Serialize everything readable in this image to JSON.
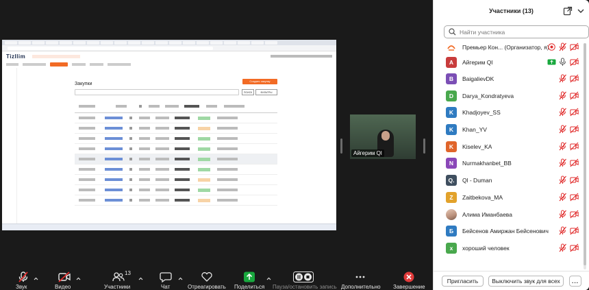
{
  "shared_screen": {
    "app_logo": "TizIlim",
    "page_title": "Закупки",
    "create_button": "Создать закупку",
    "search_button": "ПОИСК",
    "filters_button": "ФИЛЬТРЫ"
  },
  "video_tile": {
    "name": "Айгерим Ql"
  },
  "panel": {
    "title": "Участники (13)",
    "search_placeholder": "Найти участника",
    "participants": [
      {
        "name": "Премьер Кон... (Организатор, я)",
        "initial": "",
        "color": "#ffffff",
        "avatar": "logo"
      },
      {
        "name": "Айгерим Ql",
        "initial": "А",
        "color": "#c83c3c"
      },
      {
        "name": "BaigalievDK",
        "initial": "B",
        "color": "#7b4fb5"
      },
      {
        "name": "Darya_Kondratyeva",
        "initial": "D",
        "color": "#49a84d"
      },
      {
        "name": "Khadjoyev_SS",
        "initial": "K",
        "color": "#2f7bc1"
      },
      {
        "name": "Khan_YV",
        "initial": "K",
        "color": "#2f7bc1"
      },
      {
        "name": "Kiselev_KA",
        "initial": "K",
        "color": "#e0652b"
      },
      {
        "name": "Nurmakhanbet_BB",
        "initial": "N",
        "color": "#8a47b8"
      },
      {
        "name": "Ql - Duman",
        "initial": "Q.",
        "color": "#3f4f5f"
      },
      {
        "name": "Zaitbekova_MA",
        "initial": "Z",
        "color": "#e2a22b"
      },
      {
        "name": "Алима Иманбаева",
        "initial": "",
        "color": "#d9b7a7",
        "avatar": "photo"
      },
      {
        "name": "Бейсенов Амиржан Бейсенович",
        "initial": "Б",
        "color": "#2f7bc1"
      },
      {
        "name": "хороший человек",
        "initial": "х",
        "color": "#49a84d"
      }
    ],
    "invite_button": "Пригласить",
    "mute_all_button": "Выключить звук для всех",
    "more_button": "..."
  },
  "toolbar": {
    "audio": "Звук",
    "video": "Видео",
    "participants": "Участники",
    "participants_count": "13",
    "chat": "Чат",
    "react": "Отреагировать",
    "share": "Поделиться",
    "recording": "Пауза/остановить запись",
    "more": "Дополнительно",
    "end": "Завершение"
  },
  "colors": {
    "accent_orange": "#f26b25",
    "share_green": "#19a83e",
    "end_red": "#e03a3a",
    "muted_red": "#e02b2b"
  }
}
